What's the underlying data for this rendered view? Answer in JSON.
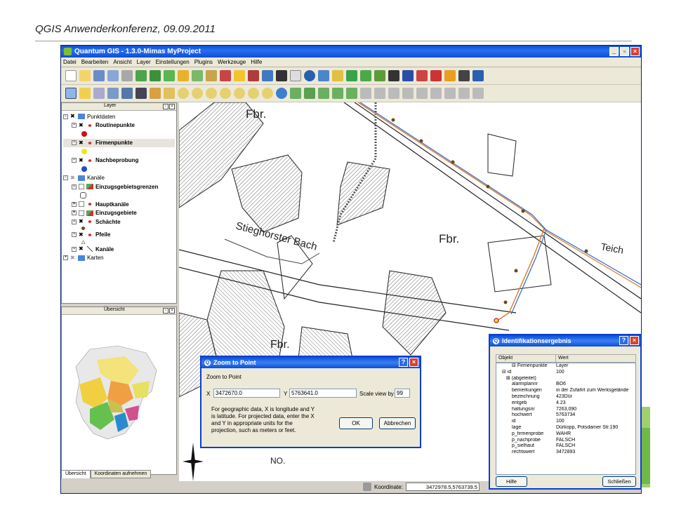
{
  "slide": {
    "title": "QGIS Anwenderkonferenz, 09.09.2011"
  },
  "app": {
    "title": "Quantum GIS - 1.3.0-Mimas MyProject",
    "menus": [
      "Datei",
      "Bearbeiten",
      "Ansicht",
      "Layer",
      "Einstellungen",
      "Plugins",
      "Werkzeuge",
      "Hilfe"
    ]
  },
  "layer_panel": {
    "title": "Layer",
    "items": [
      {
        "label": "Punktdaten",
        "bold": false,
        "level": 0,
        "type": "group"
      },
      {
        "label": "Routinepunkte",
        "bold": true,
        "level": 1,
        "type": "layer",
        "symbol": "#cc1111"
      },
      {
        "label": "Firmenpunkte",
        "bold": true,
        "level": 1,
        "type": "layer",
        "symbol": "#f1e51a",
        "selected": true
      },
      {
        "label": "Nachbeprobung",
        "bold": true,
        "level": 1,
        "type": "layer",
        "symbol": "#1e48d8"
      },
      {
        "label": "Kanäle",
        "bold": false,
        "level": 0,
        "type": "group"
      },
      {
        "label": "Einzugsgebietsgrenzen",
        "bold": true,
        "level": 1,
        "type": "layer"
      },
      {
        "label": "Hauptkanäle",
        "bold": true,
        "level": 1,
        "type": "layer"
      },
      {
        "label": "Einzugsgebiete",
        "bold": true,
        "level": 1,
        "type": "layer"
      },
      {
        "label": "Schächte",
        "bold": true,
        "level": 1,
        "type": "layer"
      },
      {
        "label": "Pfeile",
        "bold": true,
        "level": 1,
        "type": "layer"
      },
      {
        "label": "Kanäle",
        "bold": true,
        "level": 1,
        "type": "layer"
      },
      {
        "label": "Karten",
        "bold": false,
        "level": 0,
        "type": "group"
      }
    ]
  },
  "overview_panel": {
    "title": "Übersicht"
  },
  "tabs": [
    "Übersicht",
    "Koordinaten aufnehmen"
  ],
  "map_labels": {
    "fbr1": "Fbr.",
    "fbr2": "Fbr.",
    "fbr3": "Fbr.",
    "bach": "Stieghorster Bach",
    "teich": "Teich",
    "nr": "NO."
  },
  "status": {
    "label": "Koordinate:",
    "value": "3472978.5,5763739.5"
  },
  "zoom_dialog": {
    "title": "Zoom to Point",
    "heading": "Zoom to Point",
    "x_label": "X",
    "x_value": "3472670.0",
    "y_label": "Y",
    "y_value": "5763641.0",
    "scale_label": "Scale view by",
    "scale_value": "99",
    "help_text": "For geographic data, X is longitude and Y is latitude. For projected data, enter the X and Y in appropriate units for the projection, such as meters or feet.",
    "ok": "OK",
    "cancel": "Abbrechen"
  },
  "ident_dialog": {
    "title": "Identifikationsergebnis",
    "col_object": "Objekt",
    "col_value": "Wert",
    "rows": [
      {
        "k": "Firmenpunkte",
        "v": "Layer"
      },
      {
        "k": "id",
        "v": "100"
      },
      {
        "k": "(abgeleitet)",
        "v": ""
      },
      {
        "k": "alarmplannr",
        "v": "BO6"
      },
      {
        "k": "bemerkungen",
        "v": "in der Zufahrt zum Werksgelände"
      },
      {
        "k": "bezeichnung",
        "v": "423Dür"
      },
      {
        "k": "entgeb",
        "v": "4.23"
      },
      {
        "k": "haltungsnr",
        "v": "7263,090"
      },
      {
        "k": "hochwert",
        "v": "5763734"
      },
      {
        "k": "id",
        "v": "100"
      },
      {
        "k": "lage",
        "v": "Dürkopp, Potsdamer Str.190"
      },
      {
        "k": "p_firmenprobe",
        "v": "WAHR"
      },
      {
        "k": "p_nachprobe",
        "v": "FALSCH"
      },
      {
        "k": "p_sielhaut",
        "v": "FALSCH"
      },
      {
        "k": "rechtswert",
        "v": "3472893"
      }
    ],
    "help": "Hilfe",
    "close": "Schließen"
  }
}
